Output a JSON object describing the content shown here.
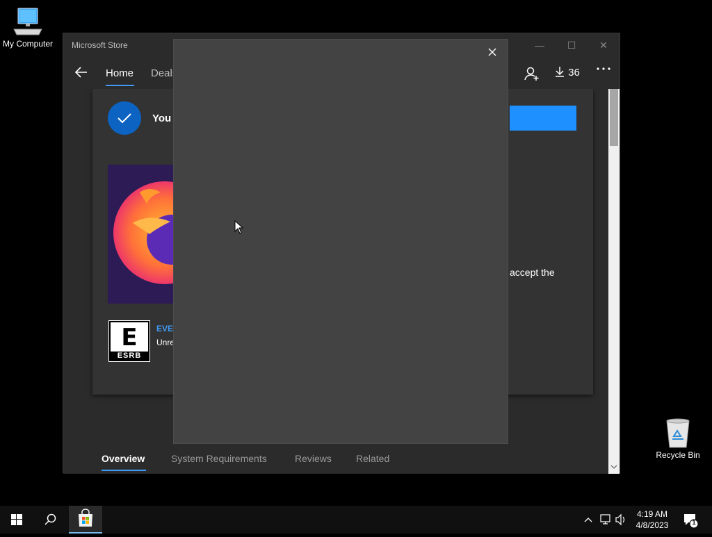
{
  "desktop": {
    "icons": [
      {
        "label": "My Computer"
      },
      {
        "label": "Recycle Bin"
      }
    ]
  },
  "window": {
    "title": "Microsoft Store",
    "controls": {
      "minimize": "—",
      "maximize": "☐",
      "close": "✕"
    }
  },
  "navbar": {
    "tabs": [
      {
        "label": "Home"
      },
      {
        "label": "Deals"
      }
    ],
    "downloads_count": "36"
  },
  "product": {
    "owned_text": "You o",
    "description_fragment": "accept the",
    "esrb_rating_title": "EVER",
    "esrb_rating_sub": "Unre",
    "esrb_badge_letter": "E",
    "esrb_badge_text": "ESRB"
  },
  "page_tabs": [
    {
      "label": "Overview"
    },
    {
      "label": "System Requirements"
    },
    {
      "label": "Reviews"
    },
    {
      "label": "Related"
    }
  ],
  "taskbar": {
    "time": "4:19 AM",
    "date": "4/8/2023",
    "notification_count": "1"
  },
  "colors": {
    "accent": "#3f9bf7",
    "owned_check": "#0c63c1",
    "primary_button": "#1e90ff",
    "dialog_bg": "#434343"
  }
}
